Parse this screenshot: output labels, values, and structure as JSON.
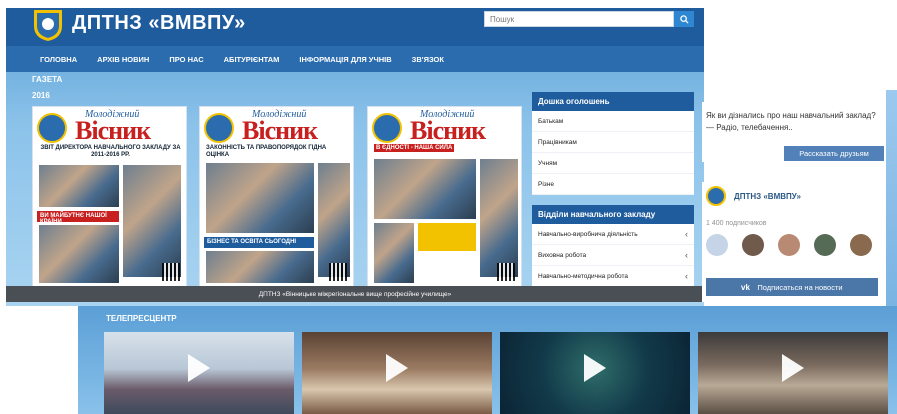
{
  "site": {
    "title": "ДПТНЗ «ВМВПУ»",
    "search_placeholder": "Пошук",
    "nav": [
      "ГОЛОВНА",
      "АРХІВ НОВИН",
      "ПРО НАС",
      "АБІТУРІЄНТАМ",
      "ІНФОРМАЦІЯ ДЛЯ УЧНІВ",
      "ЗВ'ЯЗОК"
    ],
    "section_label": "ГАЗЕТА",
    "year": "2016",
    "footer": "ДПТНЗ «Вінницьке міжрегіональне вище професійне училище»"
  },
  "newspapers": [
    {
      "masthead_small": "Молодіжний",
      "masthead_big": "Вісник",
      "headline": "ЗВІТ ДИРЕКТОРА НАВЧАЛЬНОГО ЗАКЛАДУ ЗА 2011-2016 РР.",
      "subhead": "ВИ МАЙБУТНЄ НАШОЇ КРАЇНИ"
    },
    {
      "masthead_small": "Молодіжний",
      "masthead_big": "Вісник",
      "headline": "ЗАКОННІСТЬ ТА ПРАВОПОРЯДОК ГІДНА ОЦІНКА",
      "subhead": "БІЗНЕС ТА ОСВІТА СЬОГОДНІ"
    },
    {
      "masthead_small": "Молодіжний",
      "masthead_big": "Вісник",
      "headline": "В ЄДНОСТІ - НАША СИЛА",
      "subhead": ""
    }
  ],
  "board": {
    "title": "Дошка оголошень",
    "items": [
      "Батькам",
      "Працівникам",
      "Учням",
      "Різне"
    ]
  },
  "departments": {
    "title": "Відділи навчального закладу",
    "items": [
      "Навчально-виробнича діяльність",
      "Виховна робота",
      "Навчально-методична робота"
    ]
  },
  "poll": {
    "question": "Як ви дізнались про наш навчальний заклад? — Радіо, телебачення..",
    "button": "Рассказать друзьям"
  },
  "vk": {
    "name": "ДПТНЗ «ВМВПУ»",
    "subscribers": "1 400 подписчиков",
    "button": "Подписаться на новости"
  },
  "tele": {
    "title": "ТЕЛЕПРЕСЦЕНТР"
  },
  "colors": {
    "header": "#1f5c9e",
    "nav": "#2a6cae",
    "accent": "#2f86d1",
    "vk_button": "#4a76a8"
  }
}
